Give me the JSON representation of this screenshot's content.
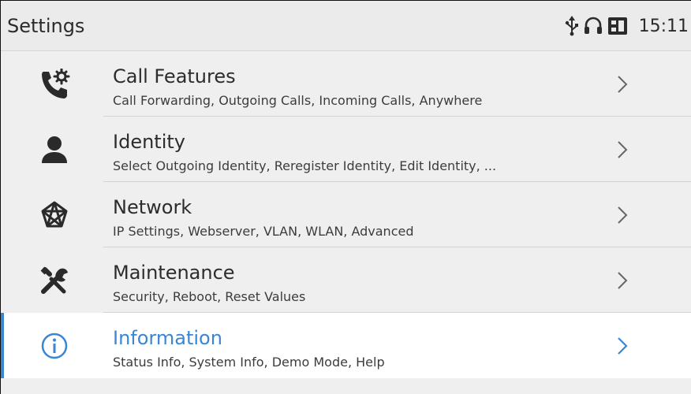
{
  "status_bar": {
    "title": "Settings",
    "time": "15:11",
    "icons": [
      "usb-icon",
      "headset-icon",
      "sim-card-icon"
    ]
  },
  "menu": {
    "items": [
      {
        "title": "Call Features",
        "subtitle": "Call Forwarding, Outgoing Calls, Incoming Calls, Anywhere",
        "icon": "phone-settings-icon"
      },
      {
        "title": "Identity",
        "subtitle": "Select Outgoing Identity, Reregister Identity, Edit Identity, ...",
        "icon": "user-icon"
      },
      {
        "title": "Network",
        "subtitle": "IP Settings, Webserver, VLAN, WLAN, Advanced",
        "icon": "network-icon"
      },
      {
        "title": "Maintenance",
        "subtitle": "Security, Reboot, Reset Values",
        "icon": "tools-icon"
      },
      {
        "title": "Information",
        "subtitle": "Status Info, System Info, Demo Mode, Help",
        "icon": "info-icon",
        "selected": true
      }
    ]
  },
  "colors": {
    "accent": "#3a86d4",
    "background": "#efefef",
    "selected_background": "#ffffff",
    "text": "#2c2c2c"
  }
}
